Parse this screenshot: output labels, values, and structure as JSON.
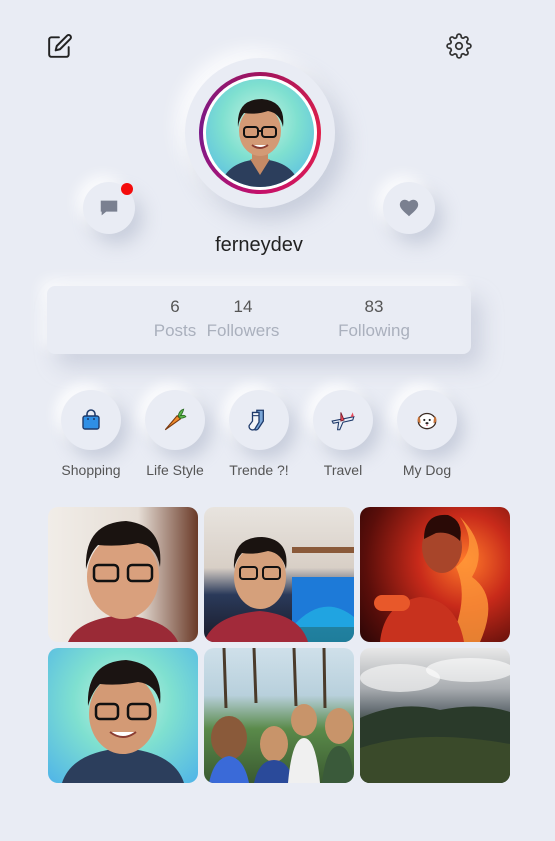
{
  "profile": {
    "username": "ferneydev",
    "has_notification": true
  },
  "stats": [
    {
      "count": "6",
      "label": "Posts"
    },
    {
      "count": "14",
      "label": "Followers"
    },
    {
      "count": "83",
      "label": "Following"
    }
  ],
  "highlights": [
    {
      "label": "Shopping",
      "icon": "shopping-bag-icon"
    },
    {
      "label": "Life Style",
      "icon": "carrot-icon"
    },
    {
      "label": "Trende ?!",
      "icon": "socks-icon"
    },
    {
      "label": "Travel",
      "icon": "airplane-icon"
    },
    {
      "label": "My Dog",
      "icon": "dog-icon"
    }
  ],
  "icons": {
    "top_left": "edit-icon",
    "top_right": "gear-icon",
    "left_round": "chat-bubble-icon",
    "right_round": "heart-icon"
  },
  "colors": {
    "background": "#e9ecf4",
    "notification": "#f40b0b",
    "story_ring": "#c4106a"
  }
}
